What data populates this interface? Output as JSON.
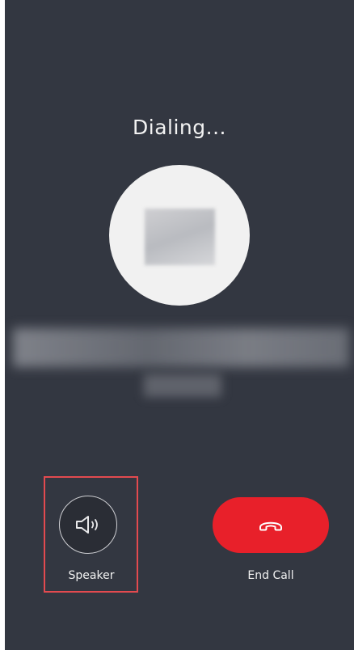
{
  "call": {
    "status": "Dialing...",
    "contact_name": "",
    "contact_detail": ""
  },
  "controls": {
    "speaker_label": "Speaker",
    "end_call_label": "End Call"
  },
  "icons": {
    "speaker": "speaker-volume-icon",
    "end_call": "phone-hangup-icon"
  },
  "colors": {
    "background": "#333741",
    "end_call": "#e8202a",
    "highlight": "#e34a4f",
    "text": "#f2f2f2"
  }
}
